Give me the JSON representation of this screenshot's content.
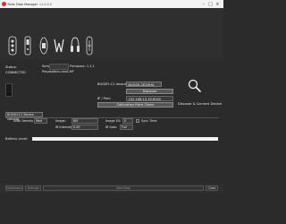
{
  "titlebar": {
    "title": "Polar Data Manager",
    "tab": "v1.0.0.0"
  },
  "status": {
    "label": "Status:",
    "value": "CONNECTED",
    "serial_label": "Serial:",
    "firmware": "Firmware: 1.1.1",
    "device_name": "Playstation-rand-HP"
  },
  "connection": {
    "devices_label": "BUGSFI-C1 devices:",
    "selected_device": "BUGSH-2E2HH4",
    "discover_button": "Discover",
    "ip_label": "IP / Port:",
    "ip_value": "192.168.10.39.8000",
    "calibration_button": "Calibration Point Check",
    "discover_connect": "Discover & Connect Device"
  },
  "settings": {
    "group_title": "BUGSH-C1 Device Settings",
    "scan_density_label": "Scan Density (dot)",
    "scan_density_value": "Med",
    "image_label": "Image:",
    "image_value": "8M",
    "image_ev_label": "Image EV:",
    "image_ev_value": "0",
    "sync_time_label": "Sync Time",
    "ir_intensity_label": "IR Intensity(%):",
    "ir_intensity_value": "0.00",
    "ir_gain_label": "IR Gain:",
    "ir_gain_value": "Full"
  },
  "battery": {
    "label": "Battery Level:",
    "level": 1.0
  },
  "bottom": {
    "left_btn1": "Dashboard",
    "left_btn2": "Settings",
    "center_btn": "Start/Stop",
    "right_btn": "Close"
  },
  "icons": {
    "logo": "app-logo",
    "devices": [
      "device-3d-scanner-icon",
      "device-handheld-icon",
      "device-bracelet-icon",
      "device-w-sensor-icon",
      "device-headset-icon",
      "device-earbud-icon"
    ],
    "search": "search-icon",
    "phone": "phone-icon"
  },
  "colors": {
    "accent": "#d32f2f",
    "background": "#2b2b2b"
  }
}
